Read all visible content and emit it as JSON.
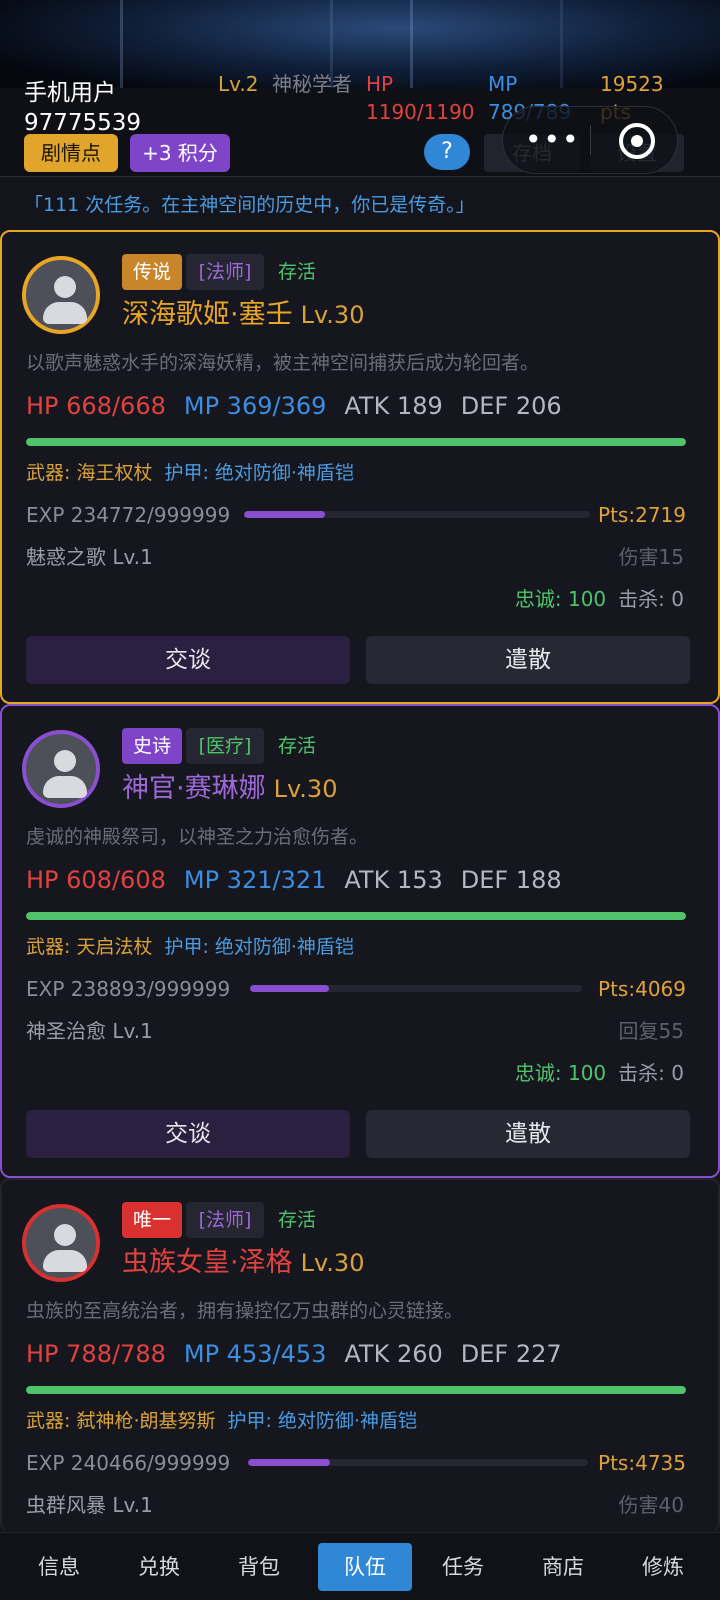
{
  "header": {
    "username": "手机用户97775539",
    "level_label": "Lv.2",
    "class": "神秘学者",
    "hp": "HP 1190/1190",
    "mp": "MP 789/789",
    "points": "19523 pts",
    "plot_button": "剧情点",
    "points_button": "+3 积分",
    "help_button": "?",
    "save_button": "存档",
    "settings_button": "设置",
    "quote": "「111 次任务。在主神空间的历史中，你已是传奇。」"
  },
  "colors": {
    "legend": "#e8a526",
    "epic": "#8a4fd0",
    "unique": "#d8312f",
    "hp": "#e0423f",
    "mp": "#3b8ee0",
    "accent": "#2f87d6",
    "alive": "#4fc46a"
  },
  "members": [
    {
      "rarity": "传说",
      "class": "[法师]",
      "status": "存活",
      "name": "深海歌姬·塞壬",
      "level": "Lv.30",
      "desc": "以歌声魅惑水手的深海妖精，被主神空间捕获后成为轮回者。",
      "hp": "HP 668/668",
      "mp": "MP 369/369",
      "atk": "ATK 189",
      "def": "DEF 206",
      "hp_fraction": 1.0,
      "weapon": "武器: 海王权杖",
      "armor": "护甲: 绝对防御·神盾铠",
      "exp": "EXP 234772/999999",
      "exp_fraction": 0.2348,
      "pts": "Pts:2719",
      "skill": "魅惑之歌 Lv.1",
      "skill_value": "伤害15",
      "loyalty": "忠诚: 100",
      "kills": "击杀: 0",
      "talk": "交谈",
      "dismiss": "遣散"
    },
    {
      "rarity": "史诗",
      "class": "[医疗]",
      "status": "存活",
      "name": "神官·赛琳娜",
      "level": "Lv.30",
      "desc": "虔诚的神殿祭司，以神圣之力治愈伤者。",
      "hp": "HP 608/608",
      "mp": "MP 321/321",
      "atk": "ATK 153",
      "def": "DEF 188",
      "hp_fraction": 1.0,
      "weapon": "武器: 天启法杖",
      "armor": "护甲: 绝对防御·神盾铠",
      "exp": "EXP 238893/999999",
      "exp_fraction": 0.2389,
      "pts": "Pts:4069",
      "skill": "神圣治愈 Lv.1",
      "skill_value": "回复55",
      "loyalty": "忠诚: 100",
      "kills": "击杀: 0",
      "talk": "交谈",
      "dismiss": "遣散"
    },
    {
      "rarity": "唯一",
      "class": "[法师]",
      "status": "存活",
      "name": "虫族女皇·泽格",
      "level": "Lv.30",
      "desc": "虫族的至高统治者，拥有操控亿万虫群的心灵链接。",
      "hp": "HP 788/788",
      "mp": "MP 453/453",
      "atk": "ATK 260",
      "def": "DEF 227",
      "hp_fraction": 1.0,
      "weapon": "武器: 弑神枪·朗基努斯",
      "armor": "护甲: 绝对防御·神盾铠",
      "exp": "EXP 240466/999999",
      "exp_fraction": 0.2405,
      "pts": "Pts:4735",
      "skill": "虫群风暴 Lv.1",
      "skill_value": "伤害40"
    }
  ],
  "nav": {
    "items": [
      "信息",
      "兑换",
      "背包",
      "队伍",
      "任务",
      "商店",
      "修炼"
    ],
    "active": "队伍"
  }
}
